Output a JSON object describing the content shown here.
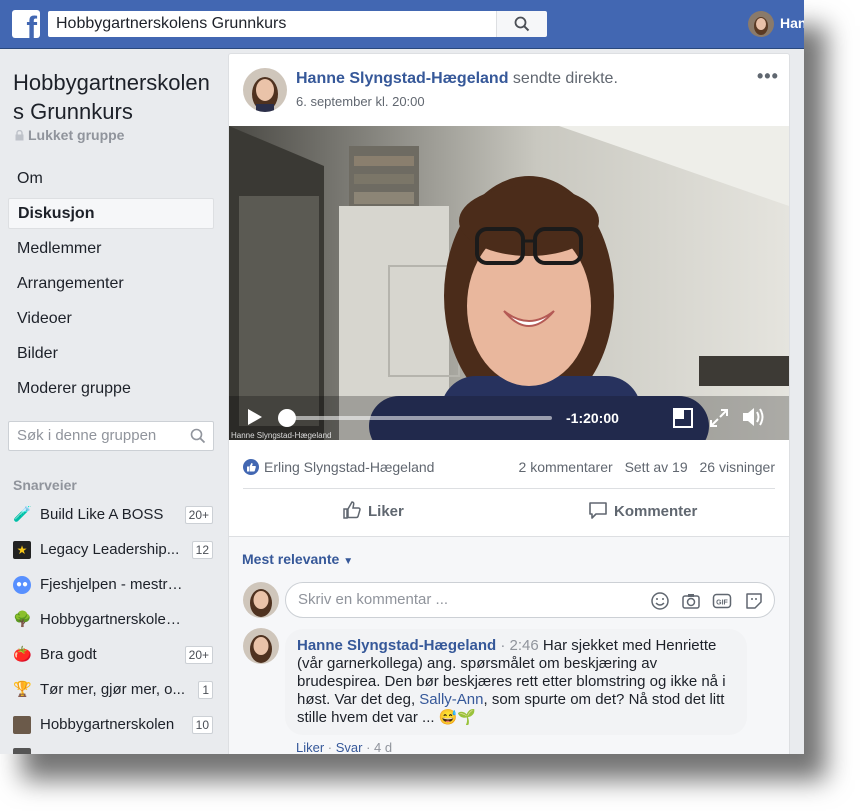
{
  "topbar": {
    "logo": "f",
    "search_value": "Hobbygartnerskolens Grunnkurs",
    "user_name": "Hanne"
  },
  "group": {
    "title": "Hobbygartnerskolens Grunnkurs",
    "privacy": "Lukket gruppe",
    "nav": [
      {
        "label": "Om",
        "active": false
      },
      {
        "label": "Diskusjon",
        "active": true
      },
      {
        "label": "Medlemmer",
        "active": false
      },
      {
        "label": "Arrangementer",
        "active": false
      },
      {
        "label": "Videoer",
        "active": false
      },
      {
        "label": "Bilder",
        "active": false
      },
      {
        "label": "Moderer gruppe",
        "active": false
      }
    ],
    "search_placeholder": "Søk i denne gruppen",
    "shortcuts_heading": "Snarveier",
    "shortcuts": [
      {
        "icon": "flask-icon",
        "label": "Build Like A BOSS",
        "badge": "20+"
      },
      {
        "icon": "star-icon",
        "label": "Legacy Leadership...",
        "badge": "12"
      },
      {
        "icon": "group-icon",
        "label": "Fjeshjelpen - mestre F...",
        "badge": ""
      },
      {
        "icon": "tree-icon",
        "label": "Hobbygartnerskolens ...",
        "badge": ""
      },
      {
        "icon": "tomato-icon",
        "label": "Bra godt",
        "badge": "20+"
      },
      {
        "icon": "trophy-icon",
        "label": "Tør mer, gjør mer, o...",
        "badge": "1"
      },
      {
        "icon": "photo-icon",
        "label": "Hobbygartnerskolen",
        "badge": "10"
      }
    ]
  },
  "post": {
    "author": "Hanne Slyngstad-Hægeland",
    "action": " sendte direkte.",
    "time": "6. september kl. 20:00",
    "menu": "•••",
    "video": {
      "remaining_time": "-1:20:00",
      "progress": 0.0,
      "watermark": "Hanne Slyngstad-Hægeland"
    },
    "reactions": {
      "liker": "Erling Slyngstad-Hægeland",
      "comments": "2 kommentarer",
      "seen": "Sett av 19",
      "views": "26 visninger"
    },
    "like_label": "Liker",
    "comment_label": "Kommenter",
    "sort_label": "Mest relevante",
    "composer_placeholder": "Skriv en kommentar ...",
    "comment": {
      "author": "Hanne Slyngstad-Hægeland",
      "timestamp": "2:46",
      "text_before": "Har sjekket med Henriette (vår garnerkollega) ang. spørsmålet om beskjæring av brudespirea. Den bør beskjæres rett etter blomstring og ikke nå i høst. Var det deg, ",
      "mention": "Sally-Ann",
      "text_after": ", som spurte om det? Nå stod det litt stille hvem det var ... 😅🌱",
      "like": "Liker",
      "reply": "Svar",
      "age": "4 d"
    }
  },
  "colors": {
    "brand": "#4267b2",
    "link": "#365899",
    "page_bg": "#e9ebee"
  }
}
